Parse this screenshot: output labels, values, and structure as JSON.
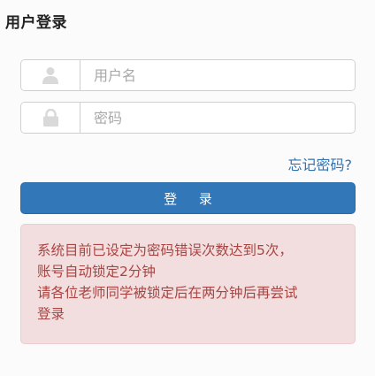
{
  "page": {
    "title": "用户登录"
  },
  "form": {
    "username_placeholder": "用户名",
    "password_placeholder": "密码",
    "forgot_password": "忘记密码?",
    "login_button": "登 录"
  },
  "alert": {
    "lines": [
      "系统目前已设定为密码错误次数达到5次，",
      "账号自动锁定2分钟",
      "请各位老师同学被锁定后在两分钟后再尝试",
      "登录"
    ]
  },
  "colors": {
    "primary": "#3277b8",
    "link": "#2f72b0",
    "alert_bg": "#f2dede",
    "alert_text": "#a94442"
  },
  "icons": {
    "username": "user-icon",
    "password": "lock-icon"
  }
}
